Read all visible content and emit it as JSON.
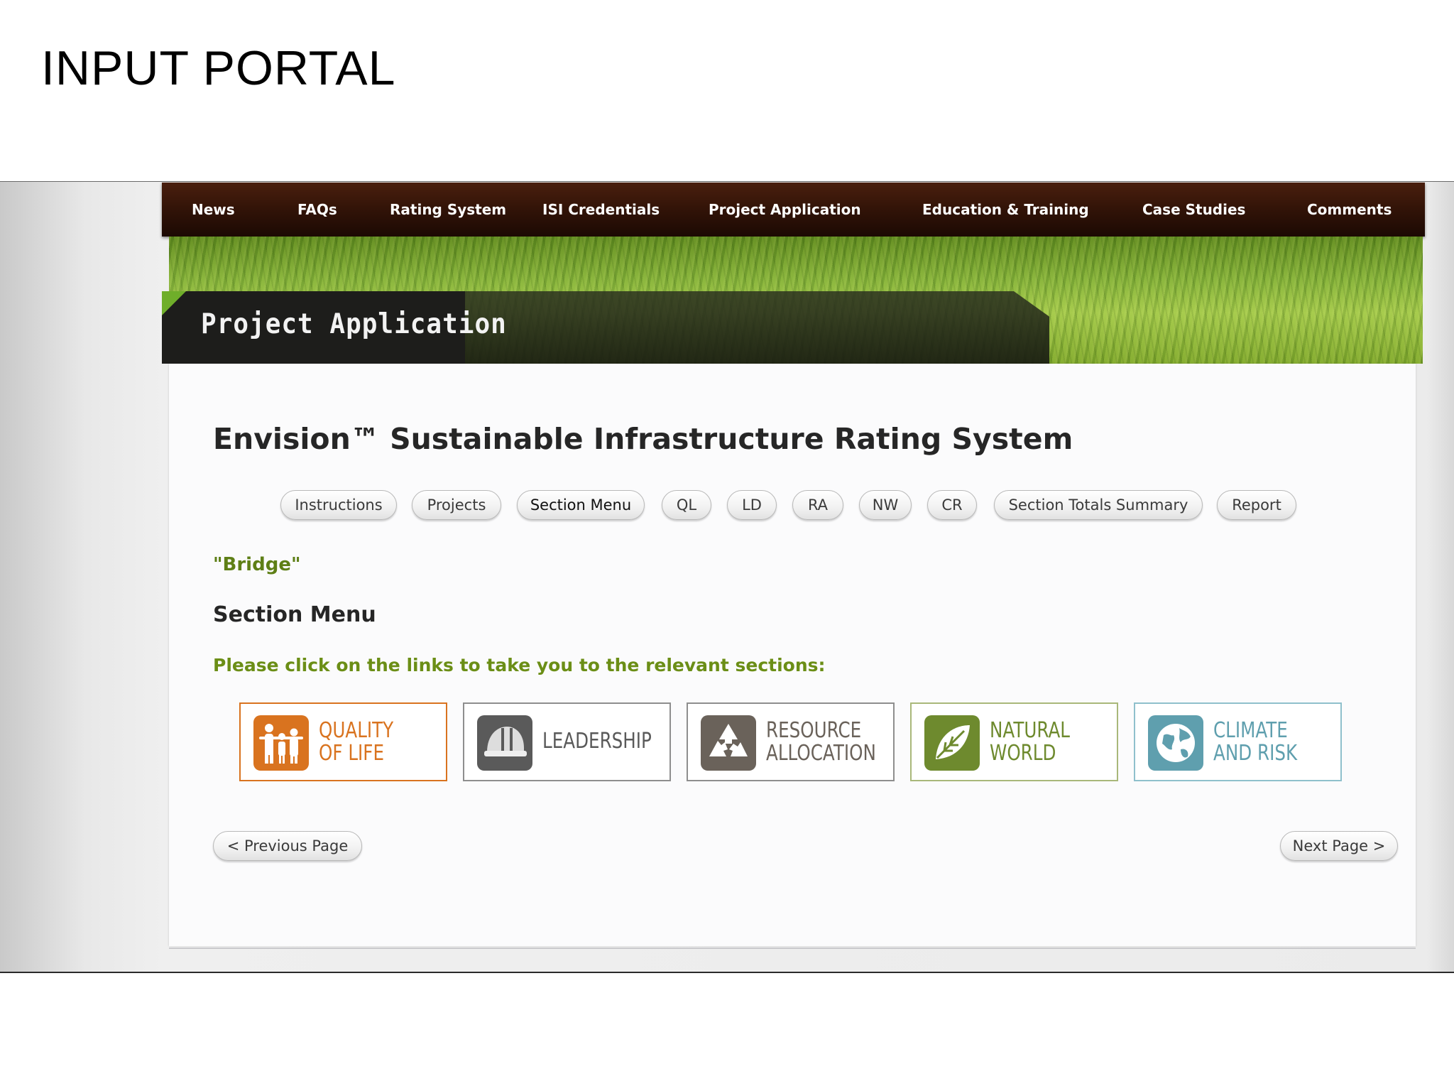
{
  "slide": {
    "title": "INPUT PORTAL"
  },
  "nav": {
    "items": [
      "News",
      "FAQs",
      "Rating System",
      "ISI Credentials",
      "Project Application",
      "Education & Training",
      "Case Studies",
      "Comments"
    ]
  },
  "banner": {
    "title": "Project Application"
  },
  "page": {
    "heading": "Envision™ Sustainable Infrastructure Rating System",
    "project_name": "\"Bridge\"",
    "section_heading": "Section Menu",
    "instruction": "Please click on the links to take you to the relevant sections:"
  },
  "subnav": {
    "items": [
      "Instructions",
      "Projects",
      "Section Menu",
      "QL",
      "LD",
      "RA",
      "NW",
      "CR",
      "Section Totals Summary",
      "Report"
    ],
    "active": "Section Menu"
  },
  "categories": [
    {
      "line1": "QUALITY",
      "line2": "OF LIFE",
      "color": "#d9731f",
      "icon": "family-icon"
    },
    {
      "line1": "LEADERSHIP",
      "line2": "",
      "color": "#5a5a5a",
      "icon": "hardhat-icon"
    },
    {
      "line1": "RESOURCE",
      "line2": "ALLOCATION",
      "color": "#6a625a",
      "icon": "recycle-icon"
    },
    {
      "line1": "NATURAL",
      "line2": "WORLD",
      "color": "#6e8a2e",
      "icon": "leaf-icon"
    },
    {
      "line1": "CLIMATE",
      "line2": "AND RISK",
      "color": "#5f9fae",
      "icon": "globe-icon"
    }
  ],
  "pager": {
    "previous": "< Previous Page",
    "next": "Next Page >"
  }
}
